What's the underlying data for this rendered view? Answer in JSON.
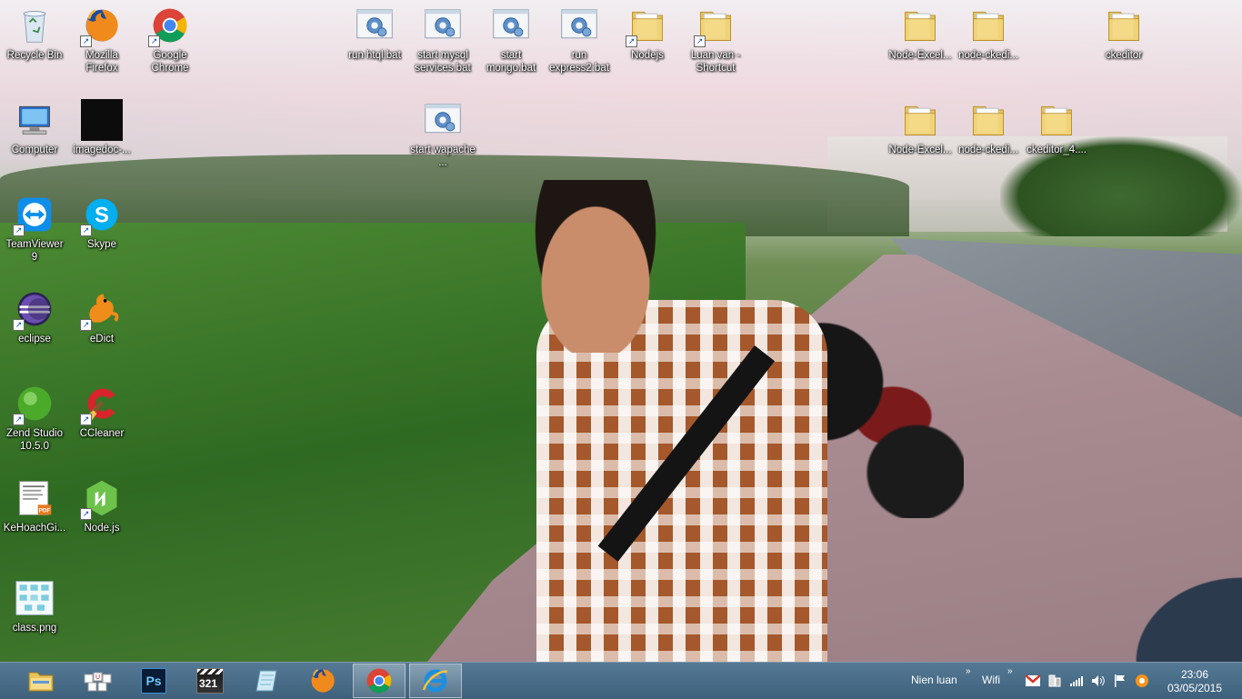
{
  "desktop": {
    "icons": [
      {
        "label": "Recycle Bin",
        "icon": "recycle-bin-icon"
      },
      {
        "label": "Mozilla Firefox",
        "icon": "firefox-icon"
      },
      {
        "label": "Google Chrome",
        "icon": "chrome-icon"
      },
      {
        "label": "run htql.bat",
        "icon": "bat-file-icon"
      },
      {
        "label": "start mysql services.bat",
        "icon": "bat-file-icon"
      },
      {
        "label": "start mongo.bat",
        "icon": "bat-file-icon"
      },
      {
        "label": "run express2.bat",
        "icon": "bat-file-icon"
      },
      {
        "label": "Nodejs",
        "icon": "folder-icon"
      },
      {
        "label": "Luan van - Shortcut",
        "icon": "folder-icon"
      },
      {
        "label": "Node-Excel...",
        "icon": "folder-icon"
      },
      {
        "label": "node-ckedi...",
        "icon": "folder-icon"
      },
      {
        "label": "ckeditor",
        "icon": "folder-icon"
      },
      {
        "label": "Computer",
        "icon": "computer-icon"
      },
      {
        "label": "imagedoc-...",
        "icon": "image-file-icon"
      },
      {
        "label": "start wapache ...",
        "icon": "bat-file-icon"
      },
      {
        "label": "Node-Excel...",
        "icon": "folder-icon"
      },
      {
        "label": "node-ckedi...",
        "icon": "folder-icon"
      },
      {
        "label": "ckeditor_4....",
        "icon": "folder-icon"
      },
      {
        "label": "TeamViewer 9",
        "icon": "teamviewer-icon"
      },
      {
        "label": "Skype",
        "icon": "skype-icon"
      },
      {
        "label": "eclipse",
        "icon": "eclipse-icon"
      },
      {
        "label": "eDict",
        "icon": "edict-icon"
      },
      {
        "label": "Zend Studio 10.5.0",
        "icon": "zend-studio-icon"
      },
      {
        "label": "CCleaner",
        "icon": "ccleaner-icon"
      },
      {
        "label": "KeHoachGi...",
        "icon": "pdf-file-icon"
      },
      {
        "label": "Node.js",
        "icon": "nodejs-icon"
      },
      {
        "label": "class.png",
        "icon": "png-file-icon"
      }
    ]
  },
  "taskbar": {
    "pinned": [
      {
        "name": "file-explorer",
        "icon": "folder-icon"
      },
      {
        "name": "unikey",
        "icon": "keyboard-icon"
      },
      {
        "name": "photoshop",
        "icon": "photoshop-icon",
        "text": "Ps"
      },
      {
        "name": "media-player",
        "icon": "media-player-icon",
        "text": "321"
      },
      {
        "name": "notes",
        "icon": "notepad-icon"
      },
      {
        "name": "firefox",
        "icon": "firefox-icon"
      },
      {
        "name": "chrome",
        "icon": "chrome-icon",
        "active": true
      },
      {
        "name": "internet-explorer",
        "icon": "ie-icon"
      }
    ],
    "tray": {
      "toolbar1": "Nien luan",
      "toolbar2": "Wifi",
      "chevron": "»",
      "icons": [
        "gmail-icon",
        "usb-device-icon",
        "signal-icon",
        "volume-icon",
        "flag-icon",
        "avast-icon"
      ],
      "time": "23:06",
      "date": "03/05/2015"
    }
  },
  "colors": {
    "taskbar": "#3f6b8e",
    "label_text": "#ffffff"
  }
}
